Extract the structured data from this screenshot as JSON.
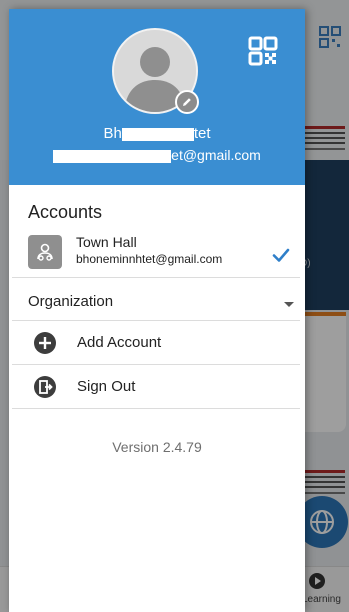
{
  "header": {
    "user_name_prefix": "Bh",
    "user_name_suffix": "tet",
    "user_email_suffix": "et@gmail.com"
  },
  "accounts": {
    "title": "Accounts",
    "items": [
      {
        "name": "Town Hall",
        "email": "bhoneminnhtet@gmail.com",
        "selected": true
      }
    ]
  },
  "organization": {
    "label": "Organization"
  },
  "menu": {
    "add_account": "Add Account",
    "sign_out": "Sign Out"
  },
  "footer": {
    "version": "Version 2.4.79"
  },
  "background": {
    "bottom_nav_label": "Learning",
    "card_text": "D)"
  },
  "colors": {
    "header_blue": "#3a8ed2",
    "check_blue": "#2f7fc9",
    "fab_blue": "#2c77b8"
  },
  "icons": {
    "qr": "qr-code-icon",
    "edit": "pencil-icon",
    "account": "org-account-icon",
    "check": "checkmark-icon",
    "add": "plus-circle-icon",
    "sign_out": "exit-door-icon",
    "dropdown": "caret-down-icon"
  }
}
